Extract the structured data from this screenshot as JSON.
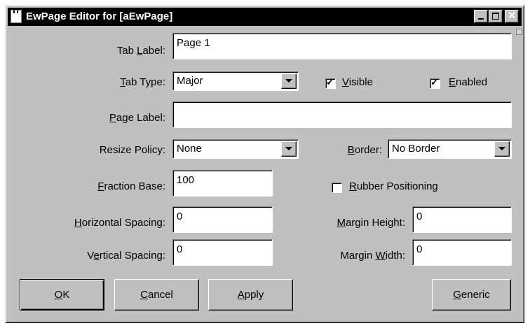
{
  "window": {
    "title": "EwPage Editor for [aEwPage]",
    "title_icon": "app-window-icon",
    "controls": [
      "minimize-icon",
      "maximize-icon",
      "close-icon"
    ]
  },
  "fields": {
    "tab_label": {
      "label_pre": "Tab ",
      "label_key": "L",
      "label_post": "abel:",
      "value": "Page 1"
    },
    "tab_type": {
      "label_pre": "",
      "label_key": "T",
      "label_post": "ab Type:",
      "value": "Major"
    },
    "page_label": {
      "label_pre": "",
      "label_key": "P",
      "label_post": "age Label:",
      "value": ""
    },
    "resize_policy": {
      "label_pre": "Resize Policy:",
      "label_key": "",
      "label_post": "",
      "value": "None"
    },
    "border": {
      "label_pre": "",
      "label_key": "B",
      "label_post": "order:",
      "value": "No Border"
    },
    "fraction_base": {
      "label_pre": "",
      "label_key": "F",
      "label_post": "raction Base:",
      "value": "100"
    },
    "horizontal_spacing": {
      "label_pre": "",
      "label_key": "H",
      "label_post": "orizontal Spacing:",
      "value": "0"
    },
    "vertical_spacing": {
      "label_pre": "V",
      "label_key": "e",
      "label_post": "rtical Spacing:",
      "value": "0"
    },
    "margin_height": {
      "label_pre": "",
      "label_key": "M",
      "label_post": "argin Height:",
      "value": "0"
    },
    "margin_width": {
      "label_pre": "Margin ",
      "label_key": "W",
      "label_post": "idth:",
      "value": "0"
    }
  },
  "checks": {
    "visible": {
      "pre": "",
      "key": "V",
      "post": "isible",
      "checked": true
    },
    "enabled": {
      "pre": "",
      "key": "E",
      "post": "nabled",
      "checked": true
    },
    "rubber": {
      "pre": "",
      "key": "R",
      "post": "ubber Positioning",
      "checked": false
    }
  },
  "buttons": {
    "ok": {
      "key": "O",
      "post": "K"
    },
    "cancel": {
      "key": "C",
      "post": "ancel"
    },
    "apply": {
      "key": "A",
      "post": "pply"
    },
    "generic": {
      "key": "G",
      "post": "eneric"
    }
  },
  "tick_glyph": "✓"
}
